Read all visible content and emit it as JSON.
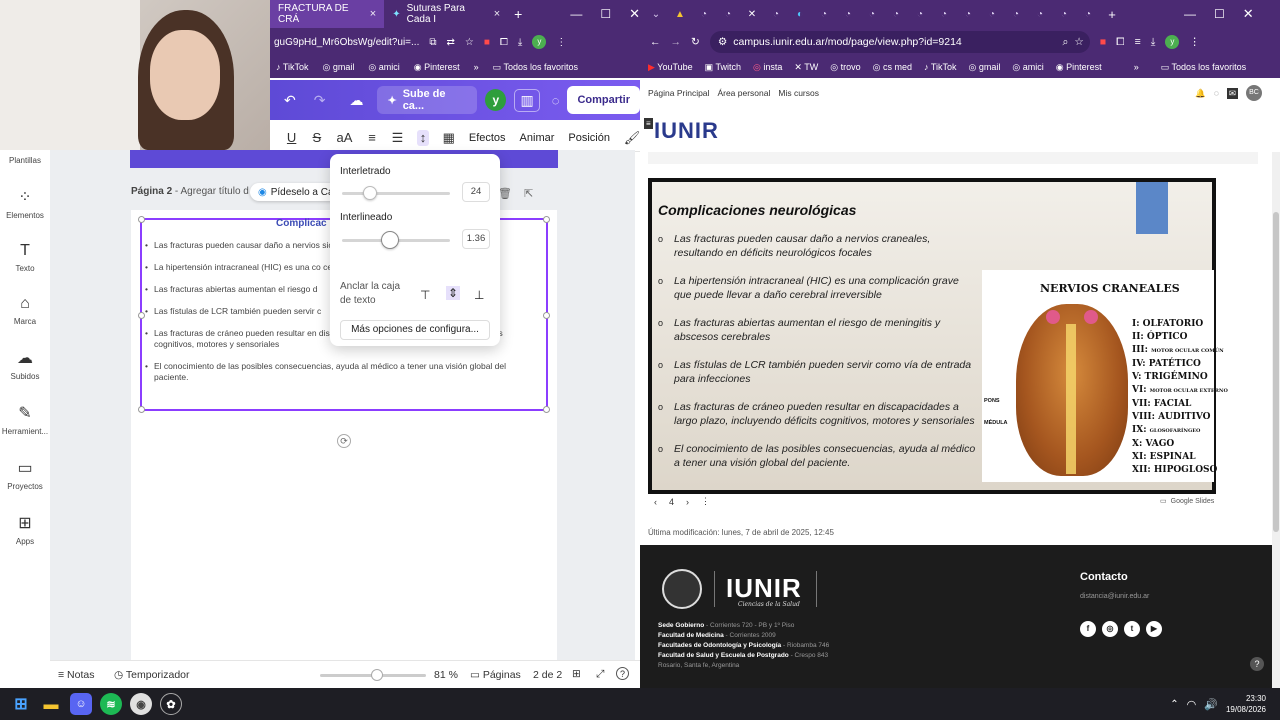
{
  "left": {
    "tabs": [
      {
        "label": "FRACTURA DE CRÁ",
        "active": true
      },
      {
        "label": "Suturas Para Cada I",
        "active": false
      }
    ],
    "url": "guG9pHd_Mr6ObsWg/edit?ui=...",
    "bookmarks": [
      "TikTok",
      "gmail",
      "amici",
      "Pinterest"
    ],
    "bookmarks_all": "Todos los favoritos",
    "canva_top": {
      "upload_label": "Sube de ca...",
      "avatar": "y",
      "share_label": "Compartir"
    },
    "toolbar2": {
      "effects": "Efectos",
      "animate": "Animar",
      "position": "Posición",
      "case_label": "aA"
    },
    "sidebar": [
      {
        "label": "Plantillas",
        "icon": "template-icon"
      },
      {
        "label": "Elementos",
        "icon": "elements-icon"
      },
      {
        "label": "Texto",
        "icon": "text-icon"
      },
      {
        "label": "Marca",
        "icon": "brand-icon"
      },
      {
        "label": "Subidos",
        "icon": "upload-icon"
      },
      {
        "label": "Herramient...",
        "icon": "tools-icon"
      },
      {
        "label": "Proyectos",
        "icon": "folder-icon"
      },
      {
        "label": "Apps",
        "icon": "apps-icon"
      }
    ],
    "page2_label": "Página 2",
    "page2_title_placeholder": "Agregar título d",
    "pidelo_label": "Pídeselo a Ca",
    "slide_title": "Complicac",
    "bullets": [
      "Las fracturas pueden causar daño a nervios                                                                       sicos focales",
      "La hipertensión intracraneal (HIC) es una co                                                                  cerebral irreversible",
      "Las fracturas abiertas aumentan el riesgo d",
      "Las fístulas de LCR también pueden servir c",
      "Las fracturas de cráneo pueden resultar en discapacidades a largo plazo, incluyendo déficits cognitivos, motores y sensoriales",
      "El conocimiento de las posibles consecuencias, ayuda al médico a tener una visión global del paciente."
    ],
    "popup": {
      "letter_spacing_label": "Interletrado",
      "letter_spacing_value": "24",
      "letter_spacing_level": 0.26,
      "line_height_label": "Interlineado",
      "line_height_value": "1.36",
      "line_height_level": 0.44,
      "anchor_label": "Anclar la caja de texto",
      "more_options": "Más opciones de configura..."
    },
    "bottom": {
      "notes": "Notas",
      "timer": "Temporizador",
      "zoom": "81 %",
      "zoom_level": 0.54,
      "pages_label": "Páginas",
      "pages_count": "2 de 2"
    }
  },
  "right": {
    "url": "campus.iunir.edu.ar/mod/page/view.php?id=9214",
    "bookmarks": [
      "YouTube",
      "Twitch",
      "insta",
      "TW",
      "trovo",
      "cs med",
      "TikTok",
      "gmail",
      "amici",
      "Pinterest"
    ],
    "bookmarks_all": "Todos los favoritos",
    "nav": [
      "Página Principal",
      "Área personal",
      "Mis cursos"
    ],
    "user_initials": "BC",
    "logo": "IUNIR",
    "slide": {
      "heading": "Complicaciones neurológicas",
      "bullets": [
        "Las fracturas pueden causar daño a nervios craneales, resultando en déficits neurológicos focales",
        "La hipertensión intracraneal (HIC) es una complicación grave que puede llevar a daño cerebral irreversible",
        "Las fracturas abiertas aumentan el riesgo de meningitis y abscesos cerebrales",
        "Las fístulas de LCR también pueden servir como vía de entrada para infecciones",
        "Las fracturas de cráneo pueden resultar en discapacidades a largo plazo, incluyendo déficits cognitivos, motores y sensoriales",
        "El conocimiento de las posibles consecuencias, ayuda al médico a tener una visión global del paciente."
      ],
      "nerves_title": "NERVIOS CRANEALES",
      "nerves": [
        {
          "num": "I:",
          "name": "OLFATORIO",
          "small": false
        },
        {
          "num": "II:",
          "name": "ÓPTICO",
          "small": false
        },
        {
          "num": "III:",
          "name": "MOTOR OCULAR COMÚN",
          "small": true
        },
        {
          "num": "IV:",
          "name": "PATÉTICO",
          "small": false
        },
        {
          "num": "V:",
          "name": "TRIGÉMINO",
          "small": false
        },
        {
          "num": "VI:",
          "name": "MOTOR OCULAR EXTERNO",
          "small": true
        },
        {
          "num": "VII:",
          "name": "FACIAL",
          "small": false
        },
        {
          "num": "VIII:",
          "name": "AUDITIVO",
          "small": false
        },
        {
          "num": "IX:",
          "name": "GLOSOFARÍNGEO",
          "small": true
        },
        {
          "num": "X:",
          "name": "VAGO",
          "small": false
        },
        {
          "num": "XI:",
          "name": "ESPINAL",
          "small": false
        },
        {
          "num": "XII:",
          "name": "HIPOGLOSO",
          "small": false
        }
      ],
      "pons": "PONS",
      "medulla": "MÉDULA"
    },
    "slide_number": "4",
    "google_slides": "Google Slides",
    "modified": "Última modificación: lunes, 7 de abril de 2025, 12:45",
    "footer": {
      "brand": "IUNIR",
      "sub": "Ciencias de la Salud",
      "addresses": [
        {
          "name": "Sede Gobierno",
          "addr": "Corrientes 720 - PB y 1º Piso"
        },
        {
          "name": "Facultad de Medicina",
          "addr": "Corrientes 2009"
        },
        {
          "name": "Facultades de Odontología y Psicología",
          "addr": "Riobamba 746"
        },
        {
          "name": "Facultad de Salud y Escuela de Postgrado",
          "addr": "Crespo 843"
        },
        {
          "name": "",
          "addr": "Rosario, Santa fe, Argentina"
        }
      ],
      "contact": "Contacto",
      "email": "distancia@iunir.edu.ar"
    }
  },
  "taskbar": {
    "time": "23:30",
    "date": "19/08/2026"
  }
}
